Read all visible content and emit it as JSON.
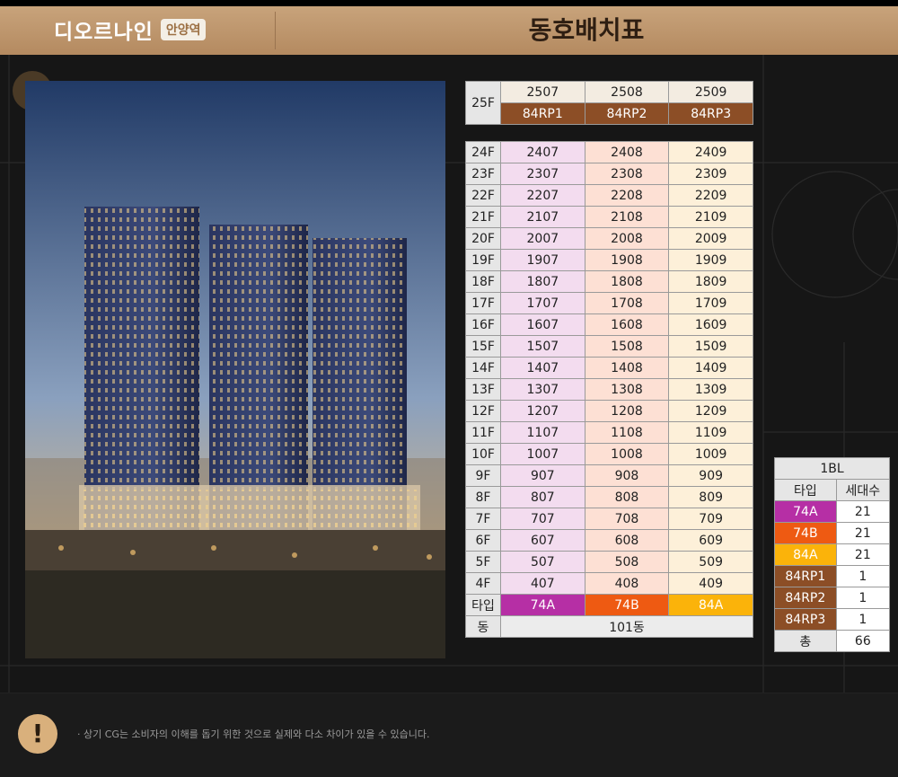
{
  "header": {
    "brand_name": "디오르나인",
    "brand_station": "안양역",
    "title": "동호배치표"
  },
  "image": {
    "subject": "apartment-exterior-rendering"
  },
  "top_floor": {
    "floor": "25F",
    "units": [
      "2507",
      "2508",
      "2509"
    ],
    "types": [
      "84RP1",
      "84RP2",
      "84RP3"
    ]
  },
  "floors": [
    {
      "floor": "24F",
      "units": [
        "2407",
        "2408",
        "2409"
      ]
    },
    {
      "floor": "23F",
      "units": [
        "2307",
        "2308",
        "2309"
      ]
    },
    {
      "floor": "22F",
      "units": [
        "2207",
        "2208",
        "2209"
      ]
    },
    {
      "floor": "21F",
      "units": [
        "2107",
        "2108",
        "2109"
      ]
    },
    {
      "floor": "20F",
      "units": [
        "2007",
        "2008",
        "2009"
      ]
    },
    {
      "floor": "19F",
      "units": [
        "1907",
        "1908",
        "1909"
      ]
    },
    {
      "floor": "18F",
      "units": [
        "1807",
        "1808",
        "1809"
      ]
    },
    {
      "floor": "17F",
      "units": [
        "1707",
        "1708",
        "1709"
      ]
    },
    {
      "floor": "16F",
      "units": [
        "1607",
        "1608",
        "1609"
      ]
    },
    {
      "floor": "15F",
      "units": [
        "1507",
        "1508",
        "1509"
      ]
    },
    {
      "floor": "14F",
      "units": [
        "1407",
        "1408",
        "1409"
      ]
    },
    {
      "floor": "13F",
      "units": [
        "1307",
        "1308",
        "1309"
      ]
    },
    {
      "floor": "12F",
      "units": [
        "1207",
        "1208",
        "1209"
      ]
    },
    {
      "floor": "11F",
      "units": [
        "1107",
        "1108",
        "1109"
      ]
    },
    {
      "floor": "10F",
      "units": [
        "1007",
        "1008",
        "1009"
      ]
    },
    {
      "floor": "9F",
      "units": [
        "907",
        "908",
        "909"
      ]
    },
    {
      "floor": "8F",
      "units": [
        "807",
        "808",
        "809"
      ]
    },
    {
      "floor": "7F",
      "units": [
        "707",
        "708",
        "709"
      ]
    },
    {
      "floor": "6F",
      "units": [
        "607",
        "608",
        "609"
      ]
    },
    {
      "floor": "5F",
      "units": [
        "507",
        "508",
        "509"
      ]
    },
    {
      "floor": "4F",
      "units": [
        "407",
        "408",
        "409"
      ]
    }
  ],
  "type_row": {
    "label": "타입",
    "types": [
      "74A",
      "74B",
      "84A"
    ]
  },
  "dong_row": {
    "label": "동",
    "value": "101동"
  },
  "summary": {
    "block": "1BL",
    "col_type": "타입",
    "col_count": "세대수",
    "rows": [
      {
        "type": "74A",
        "count": "21",
        "color": "#b62fa5"
      },
      {
        "type": "74B",
        "count": "21",
        "color": "#ee5a12"
      },
      {
        "type": "84A",
        "count": "21",
        "color": "#fbb30a"
      },
      {
        "type": "84RP1",
        "count": "1",
        "color": "#8c4e26"
      },
      {
        "type": "84RP2",
        "count": "1",
        "color": "#8c4e26"
      },
      {
        "type": "84RP3",
        "count": "1",
        "color": "#8c4e26"
      }
    ],
    "total_label": "총",
    "total_value": "66"
  },
  "notice": {
    "icon": "exclamation-icon",
    "text": "· 상기 CG는 소비자의 이해를 돕기 위한 것으로 실제와 다소 차이가 있을 수 있습니다."
  }
}
